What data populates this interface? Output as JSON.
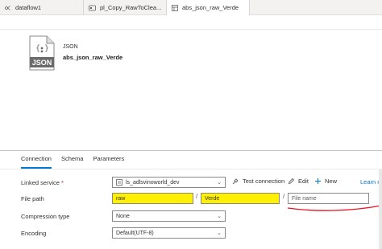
{
  "tabs": [
    {
      "label": "dataflow1",
      "icon": "dataflow-icon"
    },
    {
      "label": "pl_Copy_RawToClea...",
      "icon": "pipeline-icon"
    },
    {
      "label": "abs_json_raw_Verde",
      "icon": "dataset-icon",
      "active": true
    }
  ],
  "dataset": {
    "icon_label": "JSON",
    "type": "JSON",
    "name": "abs_json_raw_Verde"
  },
  "panel_tabs": [
    "Connection",
    "Schema",
    "Parameters"
  ],
  "form": {
    "linked_service_label": "Linked service",
    "linked_service_required": "*",
    "linked_service_value": "ls_adlsvinoworld_dev",
    "test_connection": "Test connection",
    "edit": "Edit",
    "new": "New",
    "learn_more": "Learn more",
    "file_path_label": "File path",
    "file_path_container": "raw",
    "file_path_directory": "Verde",
    "file_path_file_placeholder": "File name",
    "separator": "/",
    "compression_label": "Compression type",
    "compression_value": "None",
    "encoding_label": "Encoding",
    "encoding_value": "Default(UTF-8)"
  },
  "colors": {
    "accent": "#0078d4",
    "highlight": "#ffef00",
    "annotation": "#e81123",
    "json_icon": "#6b6b6b"
  }
}
